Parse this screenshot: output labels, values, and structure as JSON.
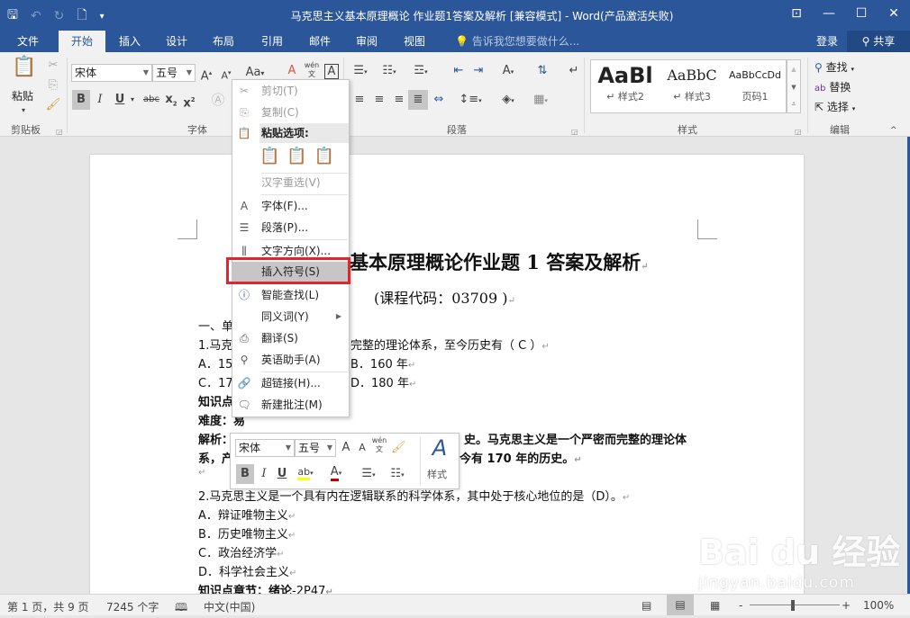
{
  "window": {
    "title": "马克思主义基本原理概论  作业题1答案及解析 [兼容模式] - Word(产品激活失败)",
    "qat_icons": [
      "save-icon",
      "undo-icon",
      "redo-icon",
      "new-doc-icon",
      "customize-qat-icon"
    ],
    "controls": {
      "ribbon_display": "⊡",
      "minimize": "—",
      "maximize": "☐",
      "close": "✕"
    }
  },
  "tabs": [
    {
      "label": "文件"
    },
    {
      "label": "开始",
      "active": true
    },
    {
      "label": "插入"
    },
    {
      "label": "设计"
    },
    {
      "label": "布局"
    },
    {
      "label": "引用"
    },
    {
      "label": "邮件"
    },
    {
      "label": "审阅"
    },
    {
      "label": "视图"
    }
  ],
  "tell_me": {
    "placeholder": "告诉我您想要做什么..."
  },
  "account": {
    "login": "登录",
    "share": "共享"
  },
  "ribbon": {
    "clipboard": {
      "paste": "粘贴",
      "label": "剪贴板"
    },
    "font": {
      "font_name": "宋体",
      "font_size": "五号",
      "label": "字体",
      "change_case": "Aa",
      "phonetic": "wén"
    },
    "paragraph": {
      "label": "段落"
    },
    "styles": {
      "label": "样式",
      "items": [
        {
          "preview": "AaBl",
          "name": "样式2"
        },
        {
          "preview": "AaBbC",
          "name": "样式3"
        },
        {
          "preview": "AaBbCcDd",
          "name": "页码1"
        }
      ]
    },
    "editing": {
      "label": "编辑",
      "find": "查找",
      "replace": "替换",
      "select": "选择"
    }
  },
  "context_menu": {
    "items": [
      {
        "label": "剪切(T)",
        "icon": "cut-icon",
        "disabled": true
      },
      {
        "label": "复制(C)",
        "icon": "copy-icon",
        "disabled": true
      },
      {
        "label": "粘贴选项:",
        "icon": "paste-icon",
        "header": true
      },
      {
        "label": "汉字重选(V)",
        "disabled": true
      },
      {
        "label": "字体(F)...",
        "icon": "font-icon"
      },
      {
        "label": "段落(P)...",
        "icon": "paragraph-icon"
      },
      {
        "label": "文字方向(X)...",
        "icon": "text-direction-icon"
      },
      {
        "label": "插入符号(S)",
        "highlighted": true
      },
      {
        "label": "智能查找(L)",
        "icon": "smart-lookup-icon"
      },
      {
        "label": "同义词(Y)",
        "submenu": true
      },
      {
        "label": "翻译(S)",
        "icon": "translate-icon"
      },
      {
        "label": "英语助手(A)",
        "icon": "english-assistant-icon"
      },
      {
        "label": "超链接(H)...",
        "icon": "hyperlink-icon"
      },
      {
        "label": "新建批注(M)",
        "icon": "new-comment-icon"
      }
    ]
  },
  "mini_toolbar": {
    "font_name": "宋体",
    "font_size": "五号",
    "styles": "样式",
    "phonetic": "wén"
  },
  "document": {
    "title_visible": "基本原理概论作业题 1 答案及解析",
    "course_code": "(课程代码：03709 )",
    "lines": [
      "一、单",
      "1.马克",
      "完整的理论体系，至今历史有（  C      ）",
      "A．15",
      "B．160 年",
      "C．17",
      "D．180 年",
      "知识点",
      "难度：易",
      "解析：",
      "史。马克思主义是一个严密而完整的理论体",
      "系，产",
      "今有 170 年的历史。",
      "2.马克思主义是一个具有内在逻辑联系的科学体系，其中处于核心地位的是（D）。",
      "A．辩证唯物主义",
      "B．历史唯物主义",
      "C．政治经济学",
      "D．科学社会主义",
      "知识点章节：绪论",
      "-2P47"
    ]
  },
  "status": {
    "page": "第 1 页，共 9 页",
    "words": "7245 个字",
    "language": "中文(中国)",
    "zoom": "100%",
    "zoom_minus": "-",
    "zoom_plus": "+"
  },
  "watermark": {
    "brand": "Bai du 经验",
    "url": "jingyan.baidu.com"
  }
}
